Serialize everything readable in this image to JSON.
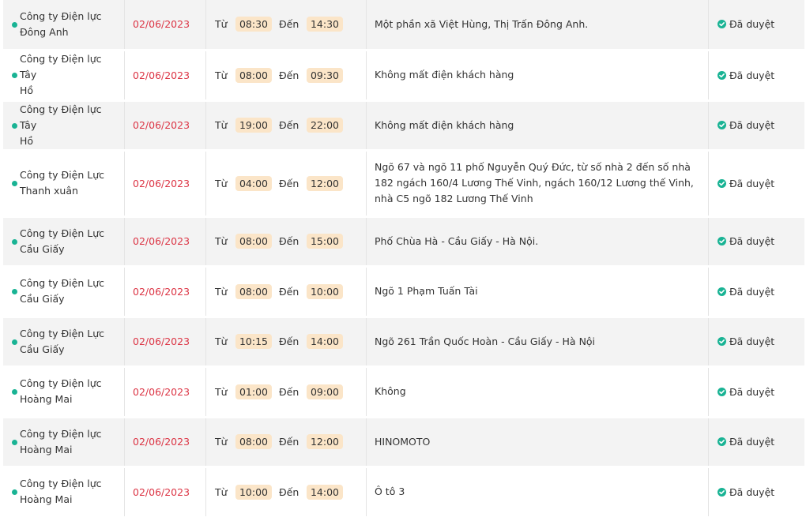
{
  "table": {
    "labels": {
      "from": "Từ",
      "to": "Đến"
    },
    "colors": {
      "accent": "#19b394",
      "date": "#dc3545",
      "pill": "#fbe5c8",
      "row_alt": "#f3f3f3"
    },
    "rows": [
      {
        "unit_line1": "Công ty Điện lực",
        "unit_line2": "Đông Anh",
        "date": "02/06/2023",
        "from": "08:30",
        "to": "14:30",
        "area": "Một phần xã Việt Hùng, Thị Trấn Đông Anh.",
        "status": "Đã duyệt"
      },
      {
        "unit_line1": "Công ty Điện lực Tây",
        "unit_line2": "Hồ",
        "date": "02/06/2023",
        "from": "08:00",
        "to": "09:30",
        "area": "Không mất điện khách hàng",
        "status": "Đã duyệt"
      },
      {
        "unit_line1": "Công ty Điện lực Tây",
        "unit_line2": "Hồ",
        "date": "02/06/2023",
        "from": "19:00",
        "to": "22:00",
        "area": "Không mất điện khách hàng",
        "status": "Đã duyệt"
      },
      {
        "unit_line1": "Công ty Điện Lực",
        "unit_line2": "Thanh xuân",
        "date": "02/06/2023",
        "from": "04:00",
        "to": "12:00",
        "area": "Ngõ 67 và ngõ 11 phố Nguyễn Quý Đức, từ số nhà 2 đến số nhà 182 ngách 160/4 Lương Thế Vinh, ngách 160/12 Lương thế Vinh, nhà C5 ngõ 182 Lương Thế Vinh",
        "status": "Đã duyệt"
      },
      {
        "unit_line1": "Công ty Điện Lực",
        "unit_line2": "Cầu Giấy",
        "date": "02/06/2023",
        "from": "08:00",
        "to": "15:00",
        "area": "Phố Chùa Hà - Cầu Giấy - Hà Nội.",
        "status": "Đã duyệt"
      },
      {
        "unit_line1": "Công ty Điện Lực",
        "unit_line2": "Cầu Giấy",
        "date": "02/06/2023",
        "from": "08:00",
        "to": "10:00",
        "area": "Ngõ 1 Phạm Tuấn Tài",
        "status": "Đã duyệt"
      },
      {
        "unit_line1": "Công ty Điện Lực",
        "unit_line2": "Cầu Giấy",
        "date": "02/06/2023",
        "from": "10:15",
        "to": "14:00",
        "area": "Ngõ 261 Trần Quốc Hoàn - Cầu Giấy - Hà Nội",
        "status": "Đã duyệt"
      },
      {
        "unit_line1": "Công ty Điện lực",
        "unit_line2": "Hoàng Mai",
        "date": "02/06/2023",
        "from": "01:00",
        "to": "09:00",
        "area": "Không",
        "status": "Đã duyệt"
      },
      {
        "unit_line1": "Công ty Điện lực",
        "unit_line2": "Hoàng Mai",
        "date": "02/06/2023",
        "from": "08:00",
        "to": "12:00",
        "area": "HINOMOTO",
        "status": "Đã duyệt"
      },
      {
        "unit_line1": "Công ty Điện lực",
        "unit_line2": "Hoàng Mai",
        "date": "02/06/2023",
        "from": "10:00",
        "to": "14:00",
        "area": "Ô tô 3",
        "status": "Đã duyệt"
      }
    ]
  }
}
